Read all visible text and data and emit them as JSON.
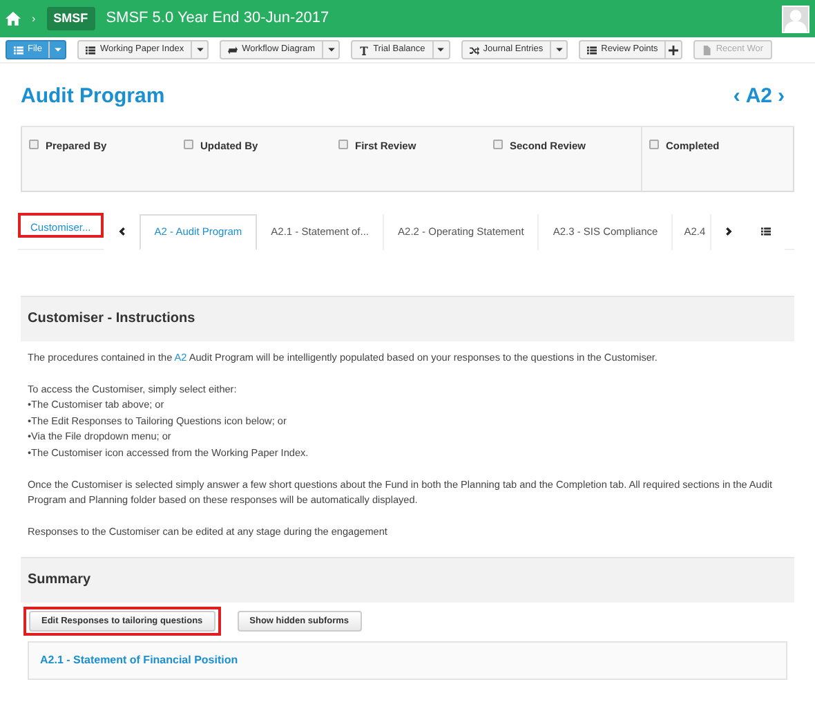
{
  "header": {
    "breadcrumb_sep": "›",
    "badge": "SMSF",
    "title": "SMSF 5.0  Year End 30-Jun-2017"
  },
  "toolbar": [
    {
      "label": "File",
      "kind": "split",
      "primary": true,
      "disabled": false
    },
    {
      "label": "Working Paper Index",
      "kind": "split",
      "primary": false,
      "disabled": false
    },
    {
      "label": "Workflow Diagram",
      "kind": "split",
      "primary": false,
      "disabled": false
    },
    {
      "label": "Trial Balance",
      "kind": "split",
      "primary": false,
      "disabled": false
    },
    {
      "label": "Journal Entries",
      "kind": "split",
      "primary": false,
      "disabled": false
    },
    {
      "label": "Review Points",
      "kind": "plus",
      "primary": false,
      "disabled": false
    },
    {
      "label": "Recent Wor",
      "kind": "plain",
      "primary": false,
      "disabled": true
    }
  ],
  "page": {
    "title": "Audit Program",
    "code": "A2",
    "prev": "‹",
    "next": "›"
  },
  "signoffs": [
    {
      "label": "Prepared By",
      "checked": false
    },
    {
      "label": "Updated By",
      "checked": false
    },
    {
      "label": "First Review",
      "checked": false
    },
    {
      "label": "Second Review",
      "checked": false
    },
    {
      "label": "Completed",
      "checked": false
    }
  ],
  "customiser_tab": {
    "label": "Customiser...",
    "highlighted": true
  },
  "tabs": [
    {
      "label": "A2 - Audit Program",
      "selected": true
    },
    {
      "label": "A2.1 - Statement of...",
      "selected": false
    },
    {
      "label": "A2.2 - Operating Statement",
      "selected": false
    },
    {
      "label": "A2.3 - SIS Compliance",
      "selected": false
    },
    {
      "label": "A2.4",
      "selected": false
    }
  ],
  "instructions": {
    "heading": "Customiser - Instructions",
    "intro": {
      "before": "The procedures contained in the ",
      "link": "A2",
      "after": " Audit Program will be intelligently populated based on your responses to the questions in the Customiser."
    },
    "access_lines": [
      "To access the Customiser, simply select either:",
      "•The Customiser tab above; or",
      "•The Edit Responses to Tailoring Questions icon below; or",
      "•Via the File dropdown menu; or",
      "•The Customiser icon accessed from the Working Paper Index."
    ],
    "paragraphs": [
      "Once the Customiser is selected simply answer a few short questions about the Fund in both the Planning tab and the Completion tab. All required sections in the Audit Program and Planning folder based on these responses will be automatically displayed.",
      "Responses to the Customiser can be edited at any stage during the engagement"
    ]
  },
  "summary": {
    "heading": "Summary",
    "buttons": [
      {
        "label": "Edit Responses to tailoring questions",
        "highlighted": true
      },
      {
        "label": "Show hidden subforms",
        "highlighted": false
      }
    ],
    "sections": [
      "A2.1 - Statement of Financial Position"
    ]
  }
}
